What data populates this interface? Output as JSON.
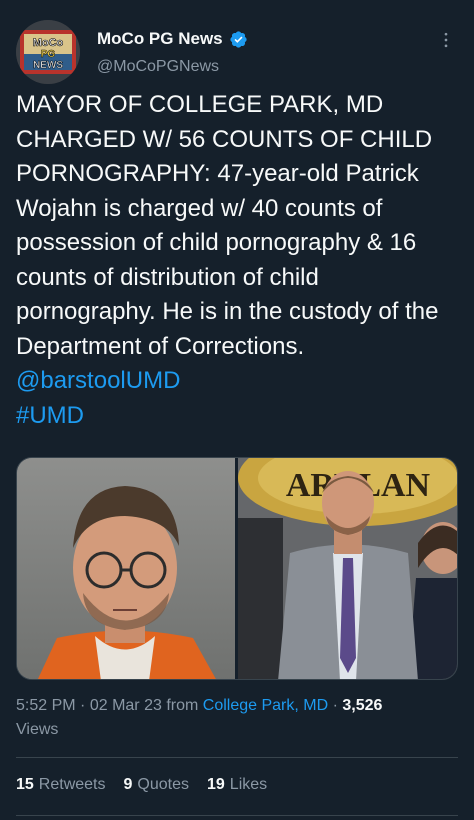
{
  "account": {
    "display_name": "MoCo PG News",
    "handle": "@MoCoPGNews",
    "avatar_text": "MoCo PG NEWS",
    "verified": true
  },
  "tweet": {
    "text": "MAYOR OF COLLEGE PARK, MD CHARGED W/ 56 COUNTS OF CHILD PORNOGRAPHY: 47-year-old Patrick Wojahn is charged w/ 40 counts of possession of child pornography & 16 counts of distribution of child pornography. He is in the custody of the Department of Corrections.",
    "mention": "@barstoolUMD",
    "hashtag": "#UMD"
  },
  "media": {
    "left_photo": "mugshot",
    "right_photo": "portrait",
    "right_photo_sign_text": "ARYLAN"
  },
  "meta": {
    "time": "5:52 PM",
    "separator": "·",
    "date": "02 Mar 23",
    "from_label": "from",
    "location": "College Park, MD",
    "views_count": "3,526",
    "views_label": "Views"
  },
  "stats": {
    "retweets_count": "15",
    "retweets_label": "Retweets",
    "quotes_count": "9",
    "quotes_label": "Quotes",
    "likes_count": "19",
    "likes_label": "Likes"
  },
  "colors": {
    "background": "#15202b",
    "text": "#f7f9f9",
    "muted": "#8b98a5",
    "accent": "#1d9bf0",
    "divider": "#38444d"
  }
}
